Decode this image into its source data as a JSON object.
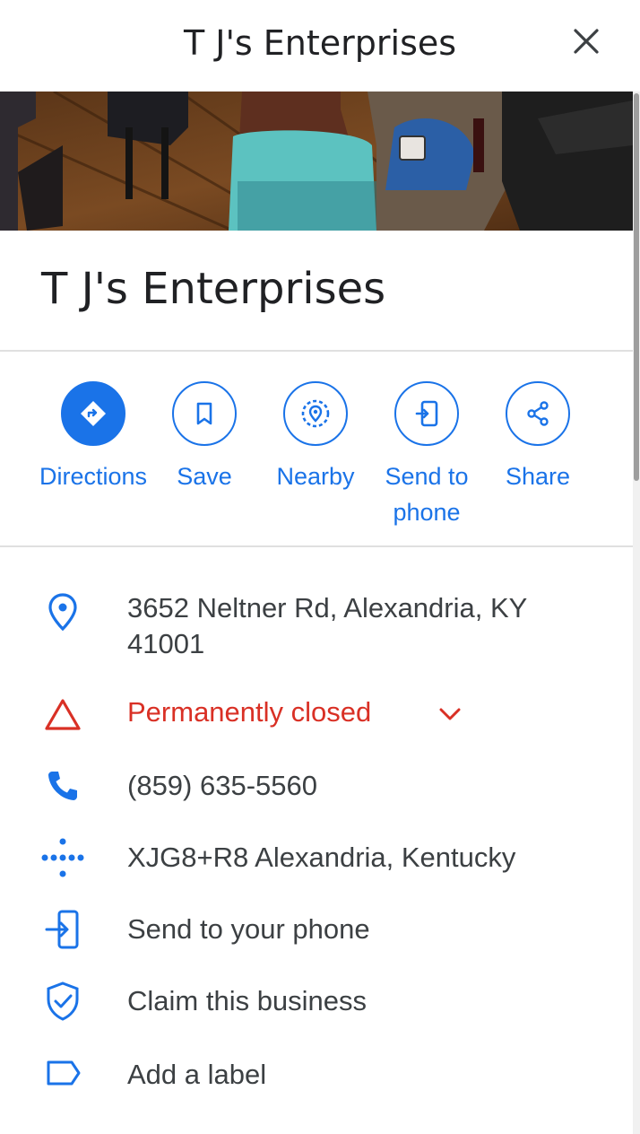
{
  "header": {
    "title": "T J's Enterprises"
  },
  "place": {
    "name": "T J's Enterprises"
  },
  "actions": [
    {
      "label": "Directions",
      "icon": "directions-icon"
    },
    {
      "label": "Save",
      "icon": "bookmark-icon"
    },
    {
      "label": "Nearby",
      "icon": "nearby-icon"
    },
    {
      "label": "Send to phone",
      "icon": "send-to-phone-icon"
    },
    {
      "label": "Share",
      "icon": "share-icon"
    }
  ],
  "info": {
    "address": "3652 Neltner Rd, Alexandria, KY 41001",
    "status": "Permanently closed",
    "phone": "(859) 635-5560",
    "plus_code": "XJG8+R8 Alexandria, Kentucky",
    "send_to_phone": "Send to your phone",
    "claim": "Claim this business",
    "label": "Add a label"
  },
  "colors": {
    "accent": "#1a73e8",
    "closed": "#d93025",
    "text": "#202124"
  }
}
